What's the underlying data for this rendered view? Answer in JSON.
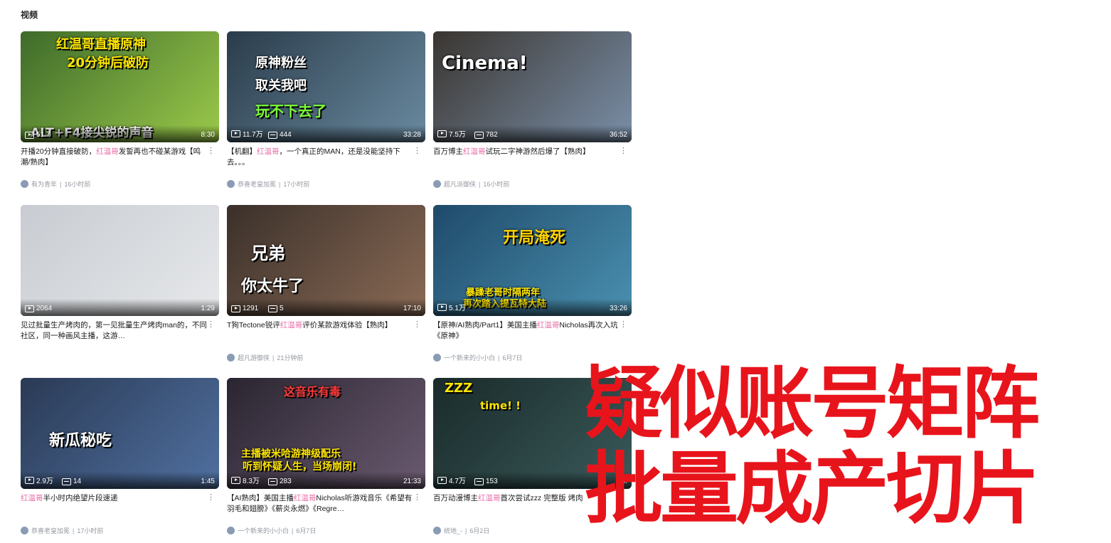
{
  "section_title": "视频",
  "cards": [
    {
      "thumb_text": [
        "红温哥直播原神",
        "20分钟后破防",
        "ALT+F4接尖锐的声音"
      ],
      "views": "51.7",
      "danmaku": "",
      "duration": "8:30",
      "title_pre": "开播20分钟直接破防，",
      "title_hl": "红温哥",
      "title_post": "发誓再也不碰某游戏【鸣潮/熟肉】",
      "author": "有为青年",
      "time": "16小时前",
      "colors": [
        "#3e6b2a",
        "#9bc94a"
      ]
    },
    {
      "thumb_text": [
        "原神粉丝",
        "取关我吧",
        "玩不下去了"
      ],
      "views": "11.7万",
      "danmaku": "444",
      "duration": "33:28",
      "title_pre": "【机翻】",
      "title_hl": "红温哥",
      "title_post": "，一个真正的MAN，还是没能坚持下去。。。",
      "author": "恭喜老皇加冕",
      "time": "17小时前",
      "colors": [
        "#2a3c4a",
        "#6a8aa0"
      ]
    },
    {
      "thumb_text": [
        "Cinema!"
      ],
      "views": "7.5万",
      "danmaku": "782",
      "duration": "36:52",
      "title_pre": "百万博主",
      "title_hl": "红温哥",
      "title_post": "试玩二字神游然后爆了【熟肉】",
      "author": "超凡派御侠",
      "time": "16小时前",
      "colors": [
        "#3a3530",
        "#7a8fa8"
      ]
    },
    {
      "thumb_text": [],
      "views": "2064",
      "danmaku": "",
      "duration": "1:29",
      "title_pre": "见过批量生产烤肉的，第一见批量生产烤肉man的，不同社区，同一种画风主播，这游…",
      "title_hl": "",
      "title_post": "",
      "author": "",
      "time": "",
      "colors": [
        "#c8ccd2",
        "#e6e8ea"
      ]
    },
    {
      "thumb_text": [
        "兄弟",
        "你太牛了"
      ],
      "views": "1291",
      "danmaku": "5",
      "duration": "17:10",
      "title_pre": "T狗Tectone锐评",
      "title_hl": "红温哥",
      "title_post": "评价某款游戏体验【熟肉】",
      "author": "超凡游御侠",
      "time": "21分钟前",
      "colors": [
        "#3a302a",
        "#8a6a55"
      ]
    },
    {
      "thumb_text": [
        "开局淹死",
        "暴躁老哥时隔两年",
        "再次踏入提瓦特大陆"
      ],
      "views": "5.1万",
      "danmaku": "",
      "duration": "33:26",
      "title_pre": "【原神/AI熟肉/Part1】美国主播",
      "title_hl": "红温哥",
      "title_post": "Nicholas再次入坑《原神》",
      "author": "一个新来的小小白",
      "time": "6月7日",
      "colors": [
        "#1f4a6a",
        "#4a90b0"
      ]
    },
    {
      "thumb_text": [
        "新瓜秘吃"
      ],
      "views": "2.9万",
      "danmaku": "14",
      "duration": "1:45",
      "title_pre": "",
      "title_hl": "红温哥",
      "title_post": "半小时内绝望片段速递",
      "author": "恭喜老皇加冕",
      "time": "17小时前",
      "colors": [
        "#2a3a55",
        "#5070a0"
      ]
    },
    {
      "thumb_text": [
        "这音乐有毒",
        "主播被米哈游神级配乐",
        "听到怀疑人生，当场崩闭!"
      ],
      "views": "8.3万",
      "danmaku": "283",
      "duration": "21:33",
      "title_pre": "【AI熟肉】美国主播",
      "title_hl": "红温哥",
      "title_post": "Nicholas听游戏音乐《希望有羽毛和翅膀》《薪炎永燃》《Regre…",
      "author": "一个新来的小小白",
      "time": "6月7日",
      "colors": [
        "#2a2530",
        "#6a5a70"
      ]
    },
    {
      "thumb_text": [
        "ZZZ",
        "time! !"
      ],
      "views": "4.7万",
      "danmaku": "153",
      "duration": "58:",
      "title_pre": "百万动漫博主",
      "title_hl": "红温哥",
      "title_post": "首次尝试zzz 完整版 烤肉",
      "author": "统地_-",
      "time": "6月2日",
      "colors": [
        "#1a2a2a",
        "#3a5a5a"
      ]
    }
  ],
  "overlay": {
    "line1": "疑似账号矩阵",
    "line2": "批量成产切片"
  }
}
